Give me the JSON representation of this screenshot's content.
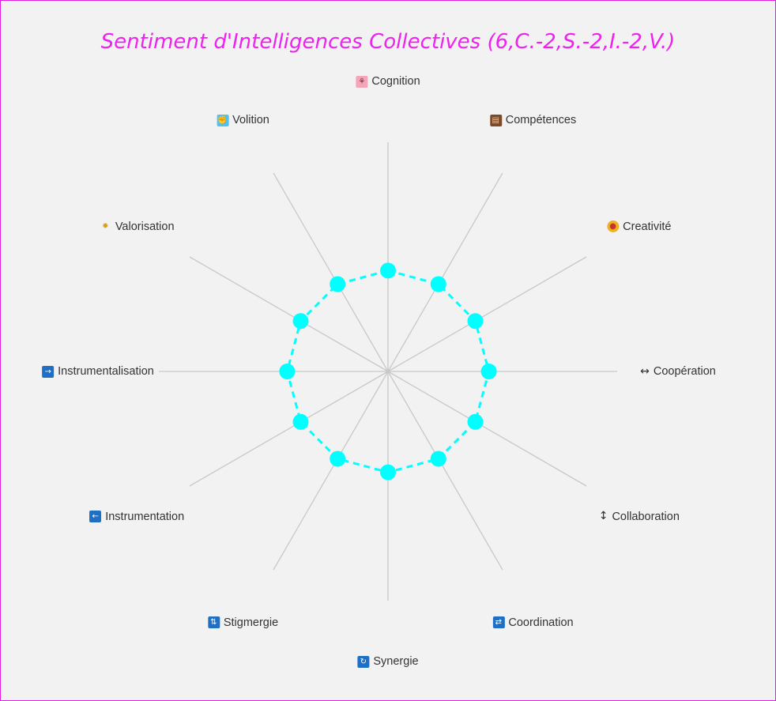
{
  "chart_data": {
    "type": "radar",
    "title": "Sentiment d'Intelligences Collectives (6,C.-2,S.-2,I.-2,V.)",
    "categories": [
      "Cognition",
      "Compétences",
      "Creativité",
      "Coopération",
      "Collaboration",
      "Coordination",
      "Synergie",
      "Stigmergie",
      "Instrumentation",
      "Instrumentalisation",
      "Valorisation",
      "Volition"
    ],
    "icons": [
      "brain-icon",
      "briefcase-icon",
      "palette-icon",
      "left-right-arrow-icon",
      "up-down-arrow-icon",
      "shuffle-icon",
      "repeat-icon",
      "cycle-arrows-icon",
      "left-arrow-icon",
      "right-arrow-icon",
      "sparkle-burst-icon",
      "flexed-arm-icon"
    ],
    "series": [
      {
        "values": [
          4.4,
          4.4,
          4.4,
          4.4,
          4.4,
          4.4,
          4.4,
          4.4,
          4.4,
          4.4,
          4.4,
          4.4
        ]
      }
    ],
    "rmax": 10,
    "colors": {
      "series": "#00ffff",
      "axis": "#c8c8c8",
      "title": "#ee22ee",
      "border": "#e020e0",
      "background": "#f2f2f2"
    },
    "grid": false,
    "line_style": "dashed"
  }
}
